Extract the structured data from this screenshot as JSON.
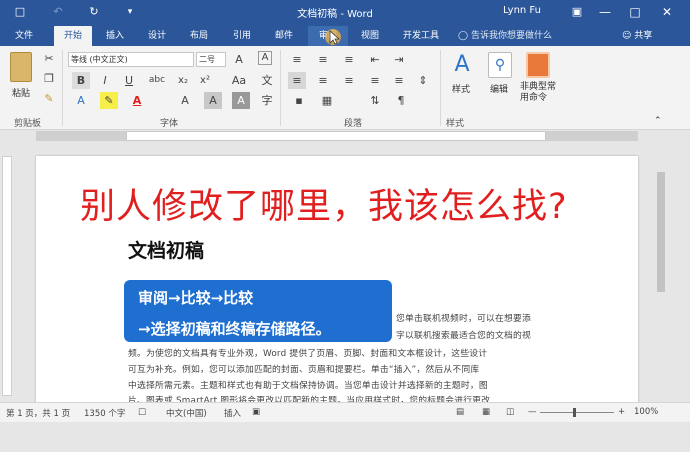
{
  "titlebar": {
    "title": "文档初稿 - Word",
    "user": "Lynn Fu",
    "save_icon": "save-icon",
    "undo_icon": "undo-icon",
    "redo_icon": "redo-icon",
    "customize_icon": "customize-icon"
  },
  "tabs": [
    {
      "label": "文件"
    },
    {
      "label": "开始"
    },
    {
      "label": "插入"
    },
    {
      "label": "设计"
    },
    {
      "label": "布局"
    },
    {
      "label": "引用"
    },
    {
      "label": "邮件"
    },
    {
      "label": "审阅"
    },
    {
      "label": "视图"
    },
    {
      "label": "开发工具"
    }
  ],
  "tellme": "告诉我你想要做什么",
  "share": "共享",
  "ribbon": {
    "clipboard": {
      "paste": "粘贴",
      "label": "剪贴板"
    },
    "font": {
      "name": "等线 (中文正文)",
      "size": "二号",
      "label": "字体"
    },
    "paragraph": {
      "label": "段落"
    },
    "styles": {
      "style": "样式",
      "edit": "编辑",
      "nonstandard": "非典型常用命令",
      "label": "样式"
    }
  },
  "document": {
    "headline": "别人修改了哪里，我该怎么找?",
    "title": "文档初稿",
    "callout_line1": "审阅→比较→比较",
    "callout_line2": "→选择初稿和终稿存储路径。",
    "body_right1": "您单击联机视频时，可以在想要添",
    "body_right2": "字以联机搜索最适合您的文档的视",
    "body": [
      "频。为使您的文档具有专业外观，Word 提供了页眉、页脚、封面和文本框设计，这些设计",
      "可互为补充。例如，您可以添加匹配的封面、页眉和提要栏。单击“插入”，然后从不同库",
      "中选择所需元素。主题和样式也有助于文档保持协调。当您单击设计并选择新的主题时，图",
      "片、图表或 SmartArt 图形将会更改以匹配新的主题。当应用样式时，您的标题会进行更改"
    ]
  },
  "status": {
    "page": "第 1 页，共 1 页",
    "words": "1350 个字",
    "lang": "中文(中国)",
    "mode": "插入",
    "zoom": "100%"
  }
}
